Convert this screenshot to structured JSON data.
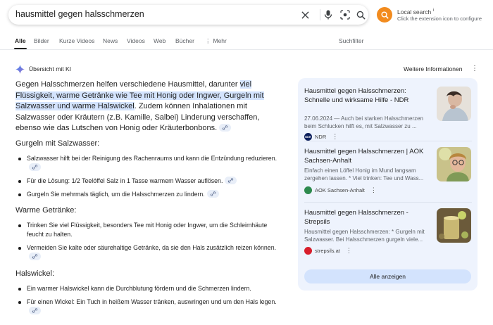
{
  "search": {
    "query": "hausmittel gegen halsschmerzen"
  },
  "extension": {
    "title": "Local search",
    "info_mark": "i",
    "subtitle": "Click the extension icon to configure"
  },
  "tabs": [
    {
      "label": "Alle"
    },
    {
      "label": "Bilder"
    },
    {
      "label": "Kurze Videos"
    },
    {
      "label": "News"
    },
    {
      "label": "Videos"
    },
    {
      "label": "Web"
    },
    {
      "label": "Bücher"
    },
    {
      "label": "Mehr"
    }
  ],
  "safesearch_label": "Suchfilter",
  "ai": {
    "heading": "Übersicht mit KI",
    "more_info": "Weitere Informationen",
    "intro_before": "Gegen Halsschmerzen helfen verschiedene Hausmittel, darunter ",
    "intro_highlight": "viel Flüssigkeit, warme Getränke wie Tee mit Honig oder Ingwer, Gurgeln mit Salzwasser und warme Halswickel",
    "intro_after": ". Zudem können Inhalationen mit Salzwasser oder Kräutern (z.B. Kamille, Salbei) Linderung verschaffen, ebenso wie das Lutschen von Honig oder Kräuterbonbons.",
    "sections": [
      {
        "title": "Gurgeln mit Salzwasser:",
        "items": [
          "Salzwasser hilft bei der Reinigung des Rachenraums und kann die Entzündung reduzieren.",
          "Für die Lösung: 1/2 Teelöffel Salz in 1 Tasse warmem Wasser auflösen.",
          "Gurgeln Sie mehrmals täglich, um die Halsschmerzen zu lindern."
        ]
      },
      {
        "title": "Warme Getränke:",
        "items": [
          "Trinken Sie viel Flüssigkeit, besonders Tee mit Honig oder Ingwer, um die Schleimhäute feucht zu halten.",
          "Vermeiden Sie kalte oder säurehaltige Getränke, da sie den Hals zusätzlich reizen können."
        ]
      },
      {
        "title": "Halswickel:",
        "items": [
          "Ein warmer Halswickel kann die Durchblutung fördern und die Schmerzen lindern.",
          "Für einen Wickel: Ein Tuch in heißem Wasser tränken, auswringen und um den Hals legen."
        ]
      }
    ]
  },
  "sources": [
    {
      "title": "Hausmittel gegen Halsschmerzen: Schnelle und wirksame Hilfe - NDR",
      "snippet": "27.06.2024 — Auch bei starken Halsschmerzen beim Schlucken hilft es, mit Salzwasser zu ...",
      "source": "NDR",
      "fav_text": "NDR",
      "fav_color": "#0c1f5c"
    },
    {
      "title": "Hausmittel gegen Halsschmerzen | AOK Sachsen-Anhalt",
      "snippet": "Einfach einen Löffel Honig im Mund langsam zergehen lassen. * Viel trinken: Tee und Wass...",
      "source": "AOK Sachsen-Anhalt",
      "fav_text": "",
      "fav_color": "#2d8a4e"
    },
    {
      "title": "Hausmittel gegen Halsschmerzen - Strepsils",
      "snippet": "Hausmittel gegen Halsschmerzen: * Gurgeln mit Salzwasser. Bei Halsschmerzen gurgeln viele...",
      "source": "strepsils.at",
      "fav_text": "",
      "fav_color": "#d81e2c"
    }
  ],
  "show_all_label": "Alle anzeigen",
  "colors": {
    "highlight": "#d3e3fd",
    "panel": "#eef3fd",
    "extension_orange": "#f28b1e"
  }
}
